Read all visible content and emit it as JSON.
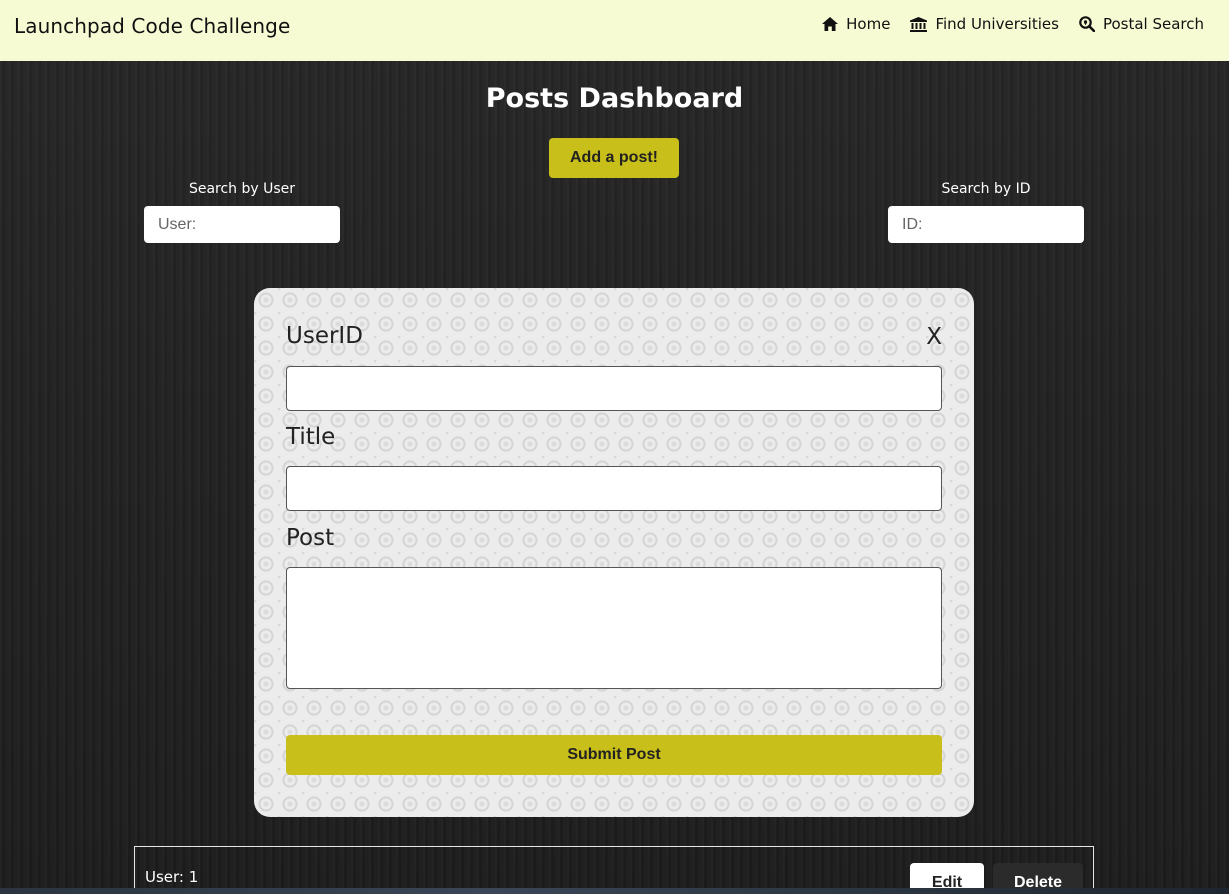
{
  "header": {
    "brand": "Launchpad Code Challenge",
    "nav": [
      {
        "label": "Home",
        "icon": "home-icon"
      },
      {
        "label": "Find Universities",
        "icon": "university-icon"
      },
      {
        "label": "Postal Search",
        "icon": "search-location-icon"
      }
    ]
  },
  "main": {
    "title": "Posts Dashboard",
    "add_post_label": "Add a post!",
    "search_user": {
      "label": "Search by User",
      "placeholder": "User:",
      "value": ""
    },
    "search_id": {
      "label": "Search by ID",
      "placeholder": "ID:",
      "value": ""
    }
  },
  "form": {
    "close_label": "X",
    "userid_label": "UserID",
    "userid_value": "",
    "title_label": "Title",
    "title_value": "",
    "post_label": "Post",
    "post_value": "",
    "submit_label": "Submit Post"
  },
  "posts": [
    {
      "user_text": "User: 1",
      "edit_label": "Edit",
      "delete_label": "Delete"
    }
  ],
  "colors": {
    "header_bg": "#f7fbd4",
    "accent": "#c8bf1a",
    "page_bg": "#1f1f1f",
    "card_bg": "#ececec"
  }
}
